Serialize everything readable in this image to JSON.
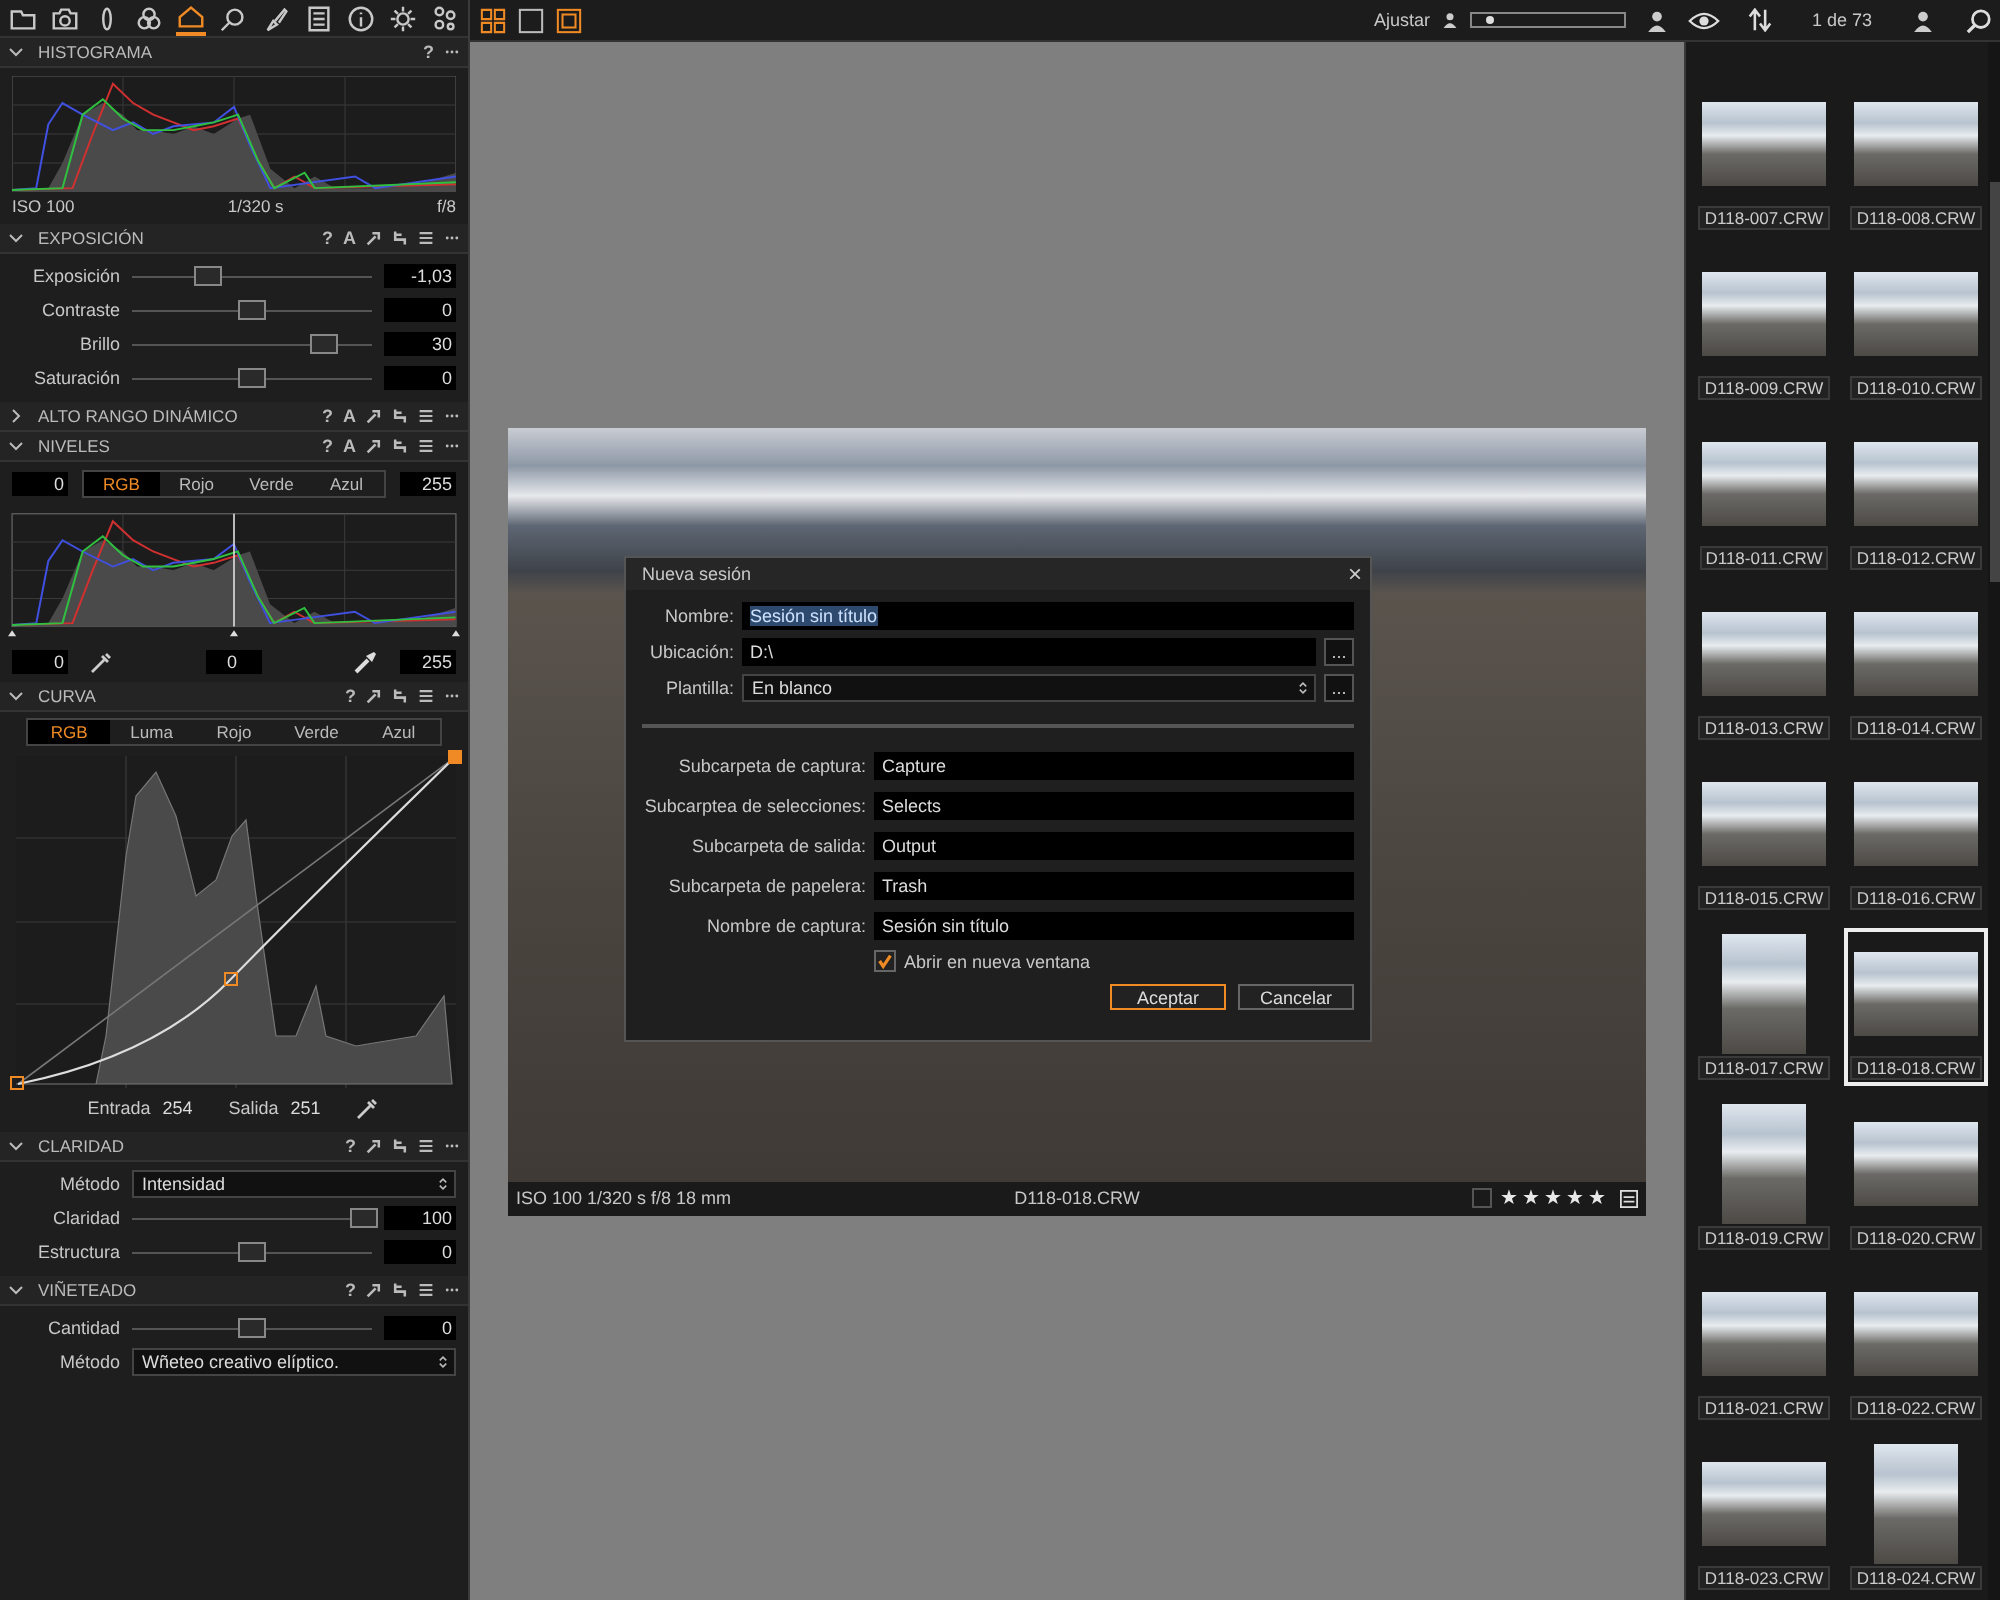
{
  "toolbar": {
    "tool_tabs": [
      {
        "kind": "folder",
        "selected": false
      },
      {
        "kind": "camera",
        "selected": false
      },
      {
        "kind": "lens",
        "selected": false
      },
      {
        "kind": "color",
        "selected": false
      },
      {
        "kind": "exposure",
        "selected": true
      },
      {
        "kind": "search",
        "selected": false
      },
      {
        "kind": "brush",
        "selected": false
      },
      {
        "kind": "list",
        "selected": false
      },
      {
        "kind": "info",
        "selected": false
      },
      {
        "kind": "gear",
        "selected": false
      },
      {
        "kind": "nodes",
        "selected": false
      }
    ],
    "view_buttons": [
      {
        "kind": "grid",
        "selected": true
      },
      {
        "kind": "single",
        "selected": false
      },
      {
        "kind": "filmstrip",
        "selected": true
      }
    ],
    "zoom": {
      "label": "Ajustar",
      "level": 0.15
    },
    "counter": "1 de 73"
  },
  "panels": [
    {
      "kind": "histogram",
      "title": "HISTOGRAMA",
      "expanded": true,
      "tools": [
        {
          "kind": "text",
          "label": "?"
        },
        {
          "kind": "more"
        }
      ],
      "iso": "ISO 100",
      "shutter": "1/320 s",
      "aperture": "f/8"
    },
    {
      "kind": "rows",
      "title": "EXPOSICIÓN",
      "expanded": true,
      "tools": [
        {
          "kind": "text",
          "label": "?"
        },
        {
          "kind": "text",
          "label": "A"
        },
        {
          "kind": "copy"
        },
        {
          "kind": "reset"
        },
        {
          "kind": "presets"
        },
        {
          "kind": "more"
        }
      ],
      "rows": [
        {
          "kind": "slider",
          "label": "Exposición",
          "level": 0.32,
          "value": "-1,03"
        },
        {
          "kind": "slider",
          "label": "Contraste",
          "level": 0.5,
          "value": "0"
        },
        {
          "kind": "slider",
          "label": "Brillo",
          "level": 0.8,
          "value": "30"
        },
        {
          "kind": "slider",
          "label": "Saturación",
          "level": 0.5,
          "value": "0"
        }
      ]
    },
    {
      "title": "ALTO RANGO DINÁMICO",
      "expanded": false,
      "tools": [
        {
          "kind": "text",
          "label": "?"
        },
        {
          "kind": "text",
          "label": "A"
        },
        {
          "kind": "copy"
        },
        {
          "kind": "reset"
        },
        {
          "kind": "presets"
        },
        {
          "kind": "more"
        }
      ]
    },
    {
      "kind": "levels",
      "title": "NIVELES",
      "expanded": true,
      "tools": [
        {
          "kind": "text",
          "label": "?"
        },
        {
          "kind": "text",
          "label": "A"
        },
        {
          "kind": "copy"
        },
        {
          "kind": "reset"
        },
        {
          "kind": "presets"
        },
        {
          "kind": "more"
        }
      ],
      "input_low": "0",
      "input_high": "255",
      "tabs": [
        {
          "label": "RGB",
          "selected": true
        },
        {
          "label": "Rojo",
          "selected": false
        },
        {
          "label": "Verde",
          "selected": false
        },
        {
          "label": "Azul",
          "selected": false
        }
      ],
      "output_low": "0",
      "midpoint": "0",
      "output_high": "255"
    },
    {
      "kind": "curve",
      "title": "CURVA",
      "expanded": true,
      "tools": [
        {
          "kind": "text",
          "label": "?"
        },
        {
          "kind": "copy"
        },
        {
          "kind": "reset"
        },
        {
          "kind": "presets"
        },
        {
          "kind": "more"
        }
      ],
      "tabs": [
        {
          "label": "RGB",
          "selected": true
        },
        {
          "label": "Luma",
          "selected": false
        },
        {
          "label": "Rojo",
          "selected": false
        },
        {
          "label": "Verde",
          "selected": false
        },
        {
          "label": "Azul",
          "selected": false
        }
      ],
      "input_label": "Entrada",
      "input_value": "254",
      "output_label": "Salida",
      "output_value": "251"
    },
    {
      "kind": "rows",
      "title": "CLARIDAD",
      "expanded": true,
      "tools": [
        {
          "kind": "text",
          "label": "?"
        },
        {
          "kind": "copy"
        },
        {
          "kind": "reset"
        },
        {
          "kind": "presets"
        },
        {
          "kind": "more"
        }
      ],
      "rows": [
        {
          "kind": "select",
          "label": "Método",
          "value": "Intensidad"
        },
        {
          "kind": "slider",
          "label": "Claridad",
          "level": 0.97,
          "value": "100"
        },
        {
          "kind": "slider",
          "label": "Estructura",
          "level": 0.5,
          "value": "0"
        }
      ]
    },
    {
      "kind": "rows",
      "title": "VIÑETEADO",
      "expanded": true,
      "tools": [
        {
          "kind": "text",
          "label": "?"
        },
        {
          "kind": "copy"
        },
        {
          "kind": "reset"
        },
        {
          "kind": "presets"
        },
        {
          "kind": "more"
        }
      ],
      "rows": [
        {
          "kind": "slider",
          "label": "Cantidad",
          "level": 0.5,
          "value": "0"
        },
        {
          "kind": "select",
          "label": "Método",
          "value": "Wñeteo creativo elíptico."
        }
      ]
    }
  ],
  "viewer": {
    "metadata": "ISO 100 1/320 s f/8 18 mm",
    "filename": "D118-018.CRW",
    "color_tag": false,
    "stars": 5
  },
  "dialog": {
    "title": "Nueva sesión",
    "close": "×",
    "fields": [
      {
        "kind": "text",
        "label": "Nombre:",
        "value": "Sesión sin título",
        "highlighted": true
      },
      {
        "kind": "browse",
        "label": "Ubicación:",
        "value": "D:\\",
        "button": "..."
      },
      {
        "kind": "select",
        "label": "Plantilla:",
        "value": "En blanco",
        "button": "..."
      }
    ],
    "folders": [
      {
        "label": "Subcarpeta de captura:",
        "value": "Capture"
      },
      {
        "label": "Subcarptea de selecciones:",
        "value": "Selects"
      },
      {
        "label": "Subcarpeta de salida:",
        "value": "Output"
      },
      {
        "label": "Subcarpeta de papelera:",
        "value": "Trash"
      },
      {
        "label": "Nombre de captura:",
        "value": "Sesión sin título"
      }
    ],
    "open_new_window": {
      "label": "Abrir en nueva ventana",
      "checked": true
    },
    "buttons": [
      {
        "label": "Aceptar",
        "primary": true
      },
      {
        "label": "Cancelar",
        "primary": false
      }
    ]
  },
  "filmstrip": [
    {
      "name": "D118-007.CRW",
      "portrait": false,
      "selected": false
    },
    {
      "name": "D118-008.CRW",
      "portrait": false,
      "selected": false
    },
    {
      "name": "D118-009.CRW",
      "portrait": false,
      "selected": false
    },
    {
      "name": "D118-010.CRW",
      "portrait": false,
      "selected": false
    },
    {
      "name": "D118-011.CRW",
      "portrait": false,
      "selected": false
    },
    {
      "name": "D118-012.CRW",
      "portrait": false,
      "selected": false
    },
    {
      "name": "D118-013.CRW",
      "portrait": false,
      "selected": false
    },
    {
      "name": "D118-014.CRW",
      "portrait": false,
      "selected": false
    },
    {
      "name": "D118-015.CRW",
      "portrait": false,
      "selected": false
    },
    {
      "name": "D118-016.CRW",
      "portrait": false,
      "selected": false
    },
    {
      "name": "D118-017.CRW",
      "portrait": true,
      "selected": false
    },
    {
      "name": "D118-018.CRW",
      "portrait": false,
      "selected": true
    },
    {
      "name": "D118-019.CRW",
      "portrait": true,
      "selected": false
    },
    {
      "name": "D118-020.CRW",
      "portrait": false,
      "selected": false
    },
    {
      "name": "D118-021.CRW",
      "portrait": false,
      "selected": false
    },
    {
      "name": "D118-022.CRW",
      "portrait": false,
      "selected": false
    },
    {
      "name": "D118-023.CRW",
      "portrait": false,
      "selected": false
    },
    {
      "name": "D118-024.CRW",
      "portrait": true,
      "selected": false
    }
  ]
}
